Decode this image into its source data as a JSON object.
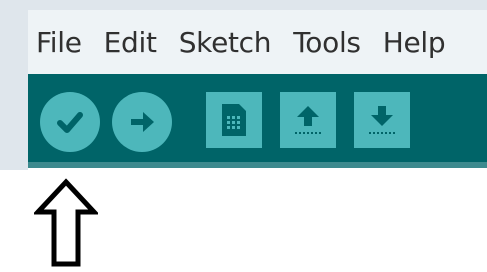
{
  "menubar": {
    "items": [
      {
        "label": "File"
      },
      {
        "label": "Edit"
      },
      {
        "label": "Sketch"
      },
      {
        "label": "Tools"
      },
      {
        "label": "Help"
      }
    ]
  },
  "toolbar": {
    "buttons": [
      {
        "icon": "checkmark-icon",
        "shape": "circle"
      },
      {
        "icon": "right-arrow-icon",
        "shape": "circle"
      },
      {
        "icon": "new-document-icon",
        "shape": "square"
      },
      {
        "icon": "open-up-arrow-icon",
        "shape": "square"
      },
      {
        "icon": "save-down-arrow-icon",
        "shape": "square"
      }
    ]
  },
  "colors": {
    "toolbar_bg": "#006468",
    "button_fill": "#4db7bb",
    "menubar_bg": "#eef3f6"
  }
}
